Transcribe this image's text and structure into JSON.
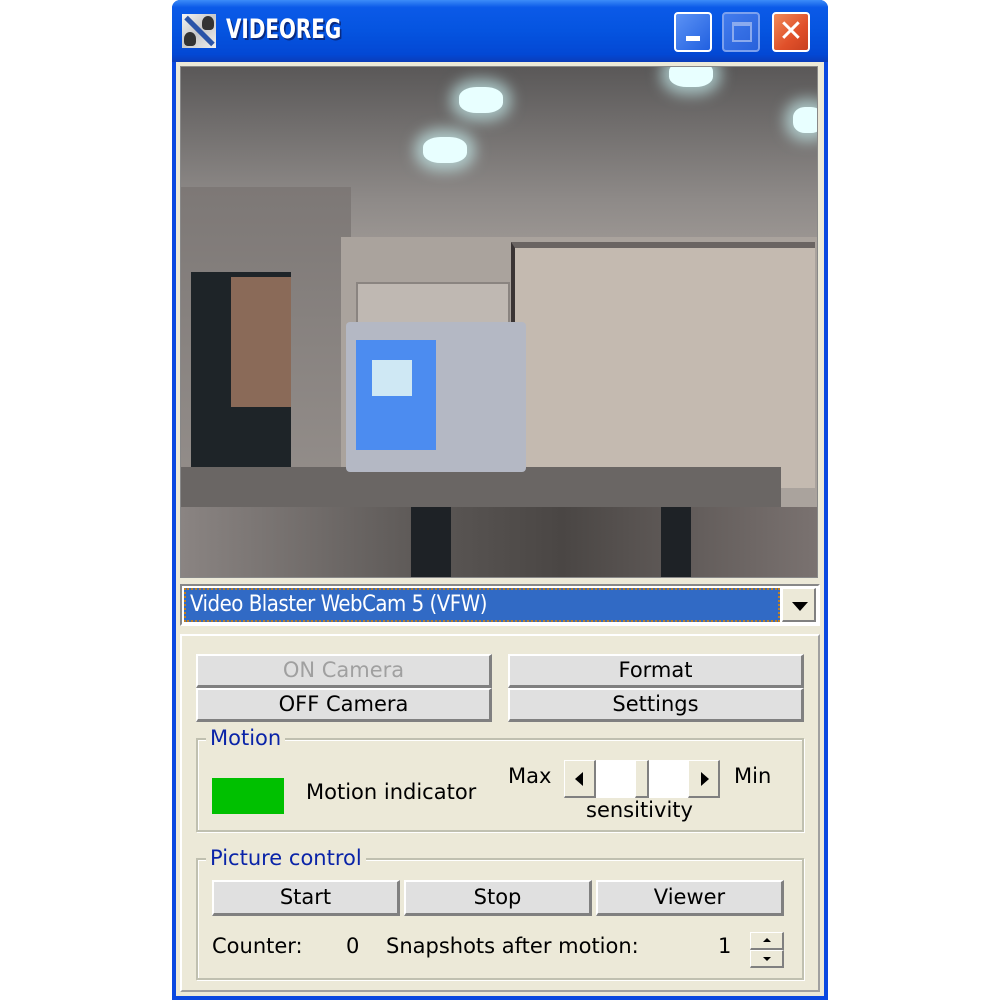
{
  "window": {
    "title": "VIDEOREG",
    "controls": {
      "minimize": "minimize-icon",
      "maximize": "maximize-icon",
      "close": "close-icon"
    }
  },
  "video": {
    "description": "Live webcam preview of an office room"
  },
  "device_select": {
    "selected": "Video Blaster WebCam 5 (VFW)"
  },
  "camera_buttons": {
    "on": {
      "label": "ON Camera",
      "enabled": false
    },
    "off": {
      "label": "OFF Camera",
      "enabled": true
    },
    "format": {
      "label": "Format",
      "enabled": true
    },
    "settings": {
      "label": "Settings",
      "enabled": true
    }
  },
  "motion": {
    "group_label": "Motion",
    "indicator_label": "Motion indicator",
    "indicator_color": "#00c000",
    "sensitivity": {
      "label": "sensitivity",
      "min_side_label": "Max",
      "max_side_label": "Min",
      "value_fraction": 0.5
    }
  },
  "picture_control": {
    "group_label": "Picture control",
    "buttons": {
      "start": "Start",
      "stop": "Stop",
      "viewer": "Viewer"
    },
    "counter_label": "Counter:",
    "counter_value": "0",
    "snapshots_label": "Snapshots after motion:",
    "snapshots_value": "1"
  },
  "colors": {
    "titlebar": "#0554e0",
    "selection": "#316ac5",
    "group_label": "#0a24a8",
    "face": "#ece9d8"
  }
}
